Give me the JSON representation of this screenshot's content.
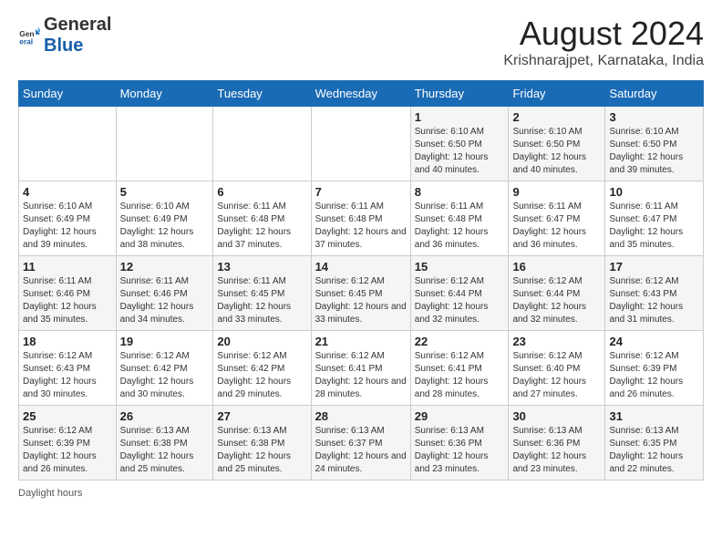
{
  "header": {
    "logo_general": "General",
    "logo_blue": "Blue",
    "month_year": "August 2024",
    "location": "Krishnarajpet, Karnataka, India"
  },
  "days_of_week": [
    "Sunday",
    "Monday",
    "Tuesday",
    "Wednesday",
    "Thursday",
    "Friday",
    "Saturday"
  ],
  "weeks": [
    [
      {
        "day": "",
        "sunrise": "",
        "sunset": "",
        "daylight": ""
      },
      {
        "day": "",
        "sunrise": "",
        "sunset": "",
        "daylight": ""
      },
      {
        "day": "",
        "sunrise": "",
        "sunset": "",
        "daylight": ""
      },
      {
        "day": "",
        "sunrise": "",
        "sunset": "",
        "daylight": ""
      },
      {
        "day": "1",
        "sunrise": "6:10 AM",
        "sunset": "6:50 PM",
        "daylight": "12 hours and 40 minutes."
      },
      {
        "day": "2",
        "sunrise": "6:10 AM",
        "sunset": "6:50 PM",
        "daylight": "12 hours and 40 minutes."
      },
      {
        "day": "3",
        "sunrise": "6:10 AM",
        "sunset": "6:50 PM",
        "daylight": "12 hours and 39 minutes."
      }
    ],
    [
      {
        "day": "4",
        "sunrise": "6:10 AM",
        "sunset": "6:49 PM",
        "daylight": "12 hours and 39 minutes."
      },
      {
        "day": "5",
        "sunrise": "6:10 AM",
        "sunset": "6:49 PM",
        "daylight": "12 hours and 38 minutes."
      },
      {
        "day": "6",
        "sunrise": "6:11 AM",
        "sunset": "6:48 PM",
        "daylight": "12 hours and 37 minutes."
      },
      {
        "day": "7",
        "sunrise": "6:11 AM",
        "sunset": "6:48 PM",
        "daylight": "12 hours and 37 minutes."
      },
      {
        "day": "8",
        "sunrise": "6:11 AM",
        "sunset": "6:48 PM",
        "daylight": "12 hours and 36 minutes."
      },
      {
        "day": "9",
        "sunrise": "6:11 AM",
        "sunset": "6:47 PM",
        "daylight": "12 hours and 36 minutes."
      },
      {
        "day": "10",
        "sunrise": "6:11 AM",
        "sunset": "6:47 PM",
        "daylight": "12 hours and 35 minutes."
      }
    ],
    [
      {
        "day": "11",
        "sunrise": "6:11 AM",
        "sunset": "6:46 PM",
        "daylight": "12 hours and 35 minutes."
      },
      {
        "day": "12",
        "sunrise": "6:11 AM",
        "sunset": "6:46 PM",
        "daylight": "12 hours and 34 minutes."
      },
      {
        "day": "13",
        "sunrise": "6:11 AM",
        "sunset": "6:45 PM",
        "daylight": "12 hours and 33 minutes."
      },
      {
        "day": "14",
        "sunrise": "6:12 AM",
        "sunset": "6:45 PM",
        "daylight": "12 hours and 33 minutes."
      },
      {
        "day": "15",
        "sunrise": "6:12 AM",
        "sunset": "6:44 PM",
        "daylight": "12 hours and 32 minutes."
      },
      {
        "day": "16",
        "sunrise": "6:12 AM",
        "sunset": "6:44 PM",
        "daylight": "12 hours and 32 minutes."
      },
      {
        "day": "17",
        "sunrise": "6:12 AM",
        "sunset": "6:43 PM",
        "daylight": "12 hours and 31 minutes."
      }
    ],
    [
      {
        "day": "18",
        "sunrise": "6:12 AM",
        "sunset": "6:43 PM",
        "daylight": "12 hours and 30 minutes."
      },
      {
        "day": "19",
        "sunrise": "6:12 AM",
        "sunset": "6:42 PM",
        "daylight": "12 hours and 30 minutes."
      },
      {
        "day": "20",
        "sunrise": "6:12 AM",
        "sunset": "6:42 PM",
        "daylight": "12 hours and 29 minutes."
      },
      {
        "day": "21",
        "sunrise": "6:12 AM",
        "sunset": "6:41 PM",
        "daylight": "12 hours and 28 minutes."
      },
      {
        "day": "22",
        "sunrise": "6:12 AM",
        "sunset": "6:41 PM",
        "daylight": "12 hours and 28 minutes."
      },
      {
        "day": "23",
        "sunrise": "6:12 AM",
        "sunset": "6:40 PM",
        "daylight": "12 hours and 27 minutes."
      },
      {
        "day": "24",
        "sunrise": "6:12 AM",
        "sunset": "6:39 PM",
        "daylight": "12 hours and 26 minutes."
      }
    ],
    [
      {
        "day": "25",
        "sunrise": "6:12 AM",
        "sunset": "6:39 PM",
        "daylight": "12 hours and 26 minutes."
      },
      {
        "day": "26",
        "sunrise": "6:13 AM",
        "sunset": "6:38 PM",
        "daylight": "12 hours and 25 minutes."
      },
      {
        "day": "27",
        "sunrise": "6:13 AM",
        "sunset": "6:38 PM",
        "daylight": "12 hours and 25 minutes."
      },
      {
        "day": "28",
        "sunrise": "6:13 AM",
        "sunset": "6:37 PM",
        "daylight": "12 hours and 24 minutes."
      },
      {
        "day": "29",
        "sunrise": "6:13 AM",
        "sunset": "6:36 PM",
        "daylight": "12 hours and 23 minutes."
      },
      {
        "day": "30",
        "sunrise": "6:13 AM",
        "sunset": "6:36 PM",
        "daylight": "12 hours and 23 minutes."
      },
      {
        "day": "31",
        "sunrise": "6:13 AM",
        "sunset": "6:35 PM",
        "daylight": "12 hours and 22 minutes."
      }
    ]
  ],
  "footer": {
    "note": "Daylight hours"
  }
}
